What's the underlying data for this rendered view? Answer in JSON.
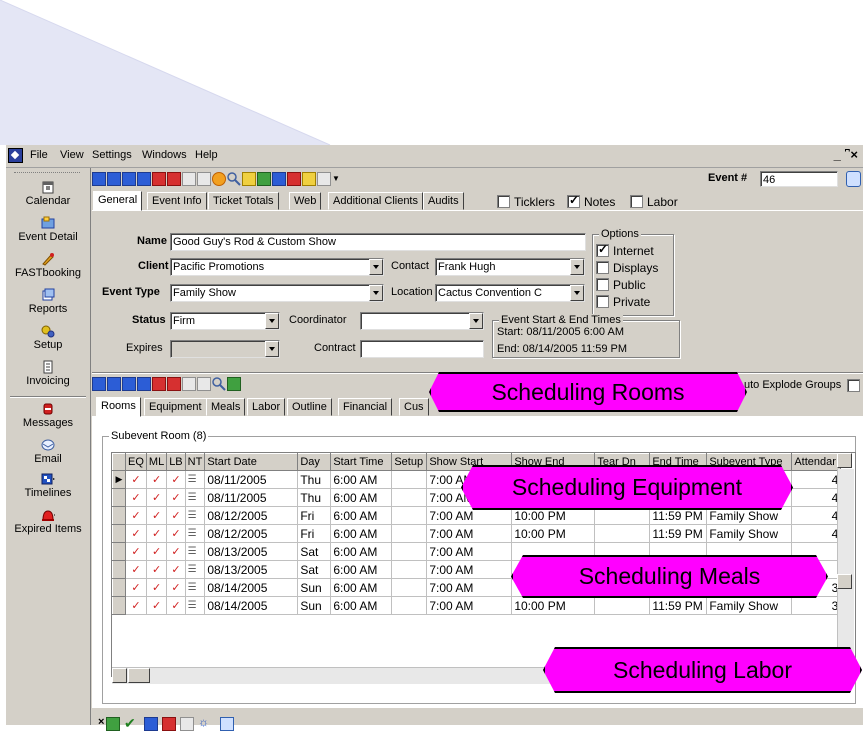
{
  "menu": {
    "items": [
      "File",
      "View",
      "Settings",
      "Windows",
      "Help"
    ],
    "window_controls": "_ ͆ ×"
  },
  "sidebar": {
    "items": [
      {
        "label": "Calendar",
        "icon": "calendar-icon"
      },
      {
        "label": "Event Detail",
        "icon": "event-detail-icon"
      },
      {
        "label": "FASTbooking",
        "icon": "fastbooking-icon"
      },
      {
        "label": "Reports",
        "icon": "reports-icon"
      },
      {
        "label": "Setup",
        "icon": "setup-icon"
      },
      {
        "label": "Invoicing",
        "icon": "invoicing-icon"
      },
      {
        "label": "Messages",
        "icon": "messages-icon"
      },
      {
        "label": "Email",
        "icon": "email-icon"
      },
      {
        "label": "Timelines",
        "icon": "timelines-icon"
      },
      {
        "label": "Expired Items",
        "icon": "expired-items-icon"
      }
    ]
  },
  "event": {
    "number_label": "Event #",
    "number_value": "46",
    "tabs": [
      "General",
      "Event Info",
      "Ticket Totals",
      "Web",
      "Additional Clients",
      "Audits"
    ],
    "header_checks": [
      {
        "label": "Ticklers",
        "checked": false
      },
      {
        "label": "Notes",
        "checked": true
      },
      {
        "label": "Labor",
        "checked": false
      }
    ],
    "form": {
      "name_label": "Name",
      "name_value": "Good Guy's Rod & Custom Show",
      "client_label": "Client",
      "client_value": "Pacific Promotions",
      "contact_label": "Contact",
      "contact_value": "Frank Hugh",
      "event_type_label": "Event Type",
      "event_type_value": "Family Show",
      "location_label": "Location",
      "location_value": "Cactus Convention C",
      "status_label": "Status",
      "status_value": "Firm",
      "coordinator_label": "Coordinator",
      "coordinator_value": "",
      "expires_label": "Expires",
      "expires_value": "",
      "contract_label": "Contract",
      "contract_value": ""
    },
    "options": {
      "title": "Options",
      "items": [
        {
          "label": "Internet",
          "checked": true
        },
        {
          "label": "Displays",
          "checked": false
        },
        {
          "label": "Public",
          "checked": false
        },
        {
          "label": "Private",
          "checked": false
        }
      ]
    },
    "times": {
      "title": "Event Start & End Times",
      "start": "Start: 08/11/2005   6:00 AM",
      "end": "End: 08/14/2005   11:59 PM"
    }
  },
  "subevent": {
    "auto_explode_label": "uto Explode Groups",
    "tabs": [
      "Rooms",
      "Equipment",
      "Meals",
      "Labor",
      "Outline",
      "Financial",
      "Cus"
    ],
    "group_title": "Subevent Room (8)",
    "columns": [
      "",
      "EQ",
      "ML",
      "LB",
      "NT",
      "Start Date",
      "Day",
      "Start Time",
      "Setup",
      "Show Start",
      "Show End",
      "Tear Dn",
      "End Time",
      "Subevent Type",
      "Attendar"
    ],
    "rows": [
      {
        "start_date": "08/11/2005",
        "day": "Thu",
        "start_time": "6:00 AM",
        "show_start": "7:00 AM",
        "show_end": "",
        "end_time": "",
        "type": "",
        "att": "4",
        "current": true
      },
      {
        "start_date": "08/11/2005",
        "day": "Thu",
        "start_time": "6:00 AM",
        "show_start": "7:00 AM",
        "show_end": "",
        "end_time": "",
        "type": "",
        "att": "4",
        "current": false
      },
      {
        "start_date": "08/12/2005",
        "day": "Fri",
        "start_time": "6:00 AM",
        "show_start": "7:00 AM",
        "show_end": "10:00 PM",
        "end_time": "11:59 PM",
        "type": "Family Show",
        "att": "4",
        "current": false
      },
      {
        "start_date": "08/12/2005",
        "day": "Fri",
        "start_time": "6:00 AM",
        "show_start": "7:00 AM",
        "show_end": "10:00 PM",
        "end_time": "11:59 PM",
        "type": "Family Show",
        "att": "4",
        "current": false
      },
      {
        "start_date": "08/13/2005",
        "day": "Sat",
        "start_time": "6:00 AM",
        "show_start": "7:00 AM",
        "show_end": "",
        "end_time": "",
        "type": "",
        "att": "",
        "current": false
      },
      {
        "start_date": "08/13/2005",
        "day": "Sat",
        "start_time": "6:00 AM",
        "show_start": "7:00 AM",
        "show_end": "",
        "end_time": "",
        "type": "",
        "att": "",
        "current": false
      },
      {
        "start_date": "08/14/2005",
        "day": "Sun",
        "start_time": "6:00 AM",
        "show_start": "7:00 AM",
        "show_end": "",
        "end_time": "",
        "type": "",
        "att": "3",
        "current": false
      },
      {
        "start_date": "08/14/2005",
        "day": "Sun",
        "start_time": "6:00 AM",
        "show_start": "7:00 AM",
        "show_end": "10:00 PM",
        "end_time": "11:59 PM",
        "type": "Family Show",
        "att": "3",
        "current": false
      }
    ]
  },
  "callouts": [
    "Scheduling Rooms",
    "Scheduling Equipment",
    "Scheduling Meals",
    "Scheduling Labor"
  ],
  "colors": {
    "callout": "#ff00ff",
    "background": "#d4d0c8",
    "triangle": "#e6e8f6"
  }
}
